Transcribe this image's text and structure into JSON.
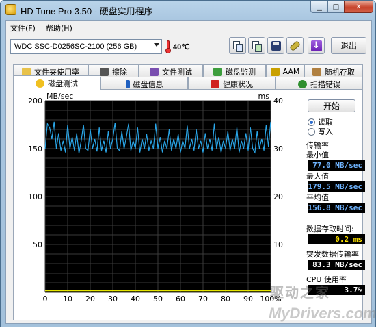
{
  "window": {
    "title": "HD Tune Pro 3.50 - 硬盘实用程序",
    "min_glyph": "▁",
    "max_glyph": "□",
    "close_glyph": "✕"
  },
  "menu": {
    "items": [
      "文件(F)",
      "帮助(H)"
    ]
  },
  "toolbar": {
    "drive": "WDC SSC-D0256SC-2100 (256 GB)",
    "temperature": "40℃",
    "exit_label": "退出",
    "exit_glyph": "↓",
    "icons": [
      "copy-text-icon",
      "copy-screenshot-icon",
      "save-icon",
      "options-icon",
      "exit-icon"
    ]
  },
  "tabs_top": [
    {
      "label": "文件夹使用率",
      "icon": "folder-icon",
      "color": "#e8c24a"
    },
    {
      "label": "擦除",
      "icon": "trash-icon",
      "color": "#555555"
    },
    {
      "label": "文件测试",
      "icon": "file-test-icon",
      "color": "#7a4fb0"
    },
    {
      "label": "磁盘监测",
      "icon": "disk-monitor-icon",
      "color": "#3d9e3d"
    },
    {
      "label": "AAM",
      "icon": "speaker-icon",
      "color": "#c9a000"
    },
    {
      "label": "随机存取",
      "icon": "random-access-icon",
      "color": "#b08040"
    }
  ],
  "tabs_bottom": [
    {
      "label": "磁盘测试",
      "icon": "benchmark-icon",
      "color": "#f0c020",
      "active": true
    },
    {
      "label": "磁盘信息",
      "icon": "info-icon",
      "color": "#2060c0",
      "active": false
    },
    {
      "label": "健康状况",
      "icon": "health-cross-icon",
      "color": "#d02020",
      "active": false
    },
    {
      "label": "扫描错误",
      "icon": "magnifier-icon",
      "color": "#2f8f2f",
      "active": false
    }
  ],
  "benchmark": {
    "start_label": "开始",
    "read_label": "读取",
    "write_label": "写入",
    "transfer_rate_label": "传输率",
    "min_label": "最小值",
    "min_value": "77.0 MB/sec",
    "max_label": "最大值",
    "max_value": "179.5 MB/sec",
    "avg_label": "平均值",
    "avg_value": "156.8 MB/sec",
    "access_time_label": "数据存取时间:",
    "access_time_value": "0.2 ms",
    "burst_rate_label": "突发数据传输率",
    "burst_rate_value": "83.3 MB/sec",
    "cpu_label": "CPU 使用率",
    "cpu_value": "3.7%"
  },
  "watermark": {
    "line1": "驱动之家",
    "line2": "MyDrivers.com"
  },
  "chart_data": {
    "type": "line",
    "ylabel": "MB/sec",
    "y2label": "ms",
    "ylim": [
      0,
      200
    ],
    "y2lim": [
      0,
      40
    ],
    "xlim": [
      0,
      100
    ],
    "y_ticks": [
      "200",
      "150",
      "100",
      "50"
    ],
    "y2_ticks": [
      "40",
      "30",
      "20",
      "10"
    ],
    "x_ticks": [
      "0",
      "10",
      "20",
      "30",
      "40",
      "50",
      "60",
      "70",
      "80",
      "90",
      "100%"
    ],
    "grid": true,
    "background": "#000000",
    "series": [
      {
        "color": "#2aa6e8",
        "x": [
          0,
          1,
          2,
          3,
          4,
          5,
          6,
          7,
          8,
          9,
          10,
          11,
          12,
          13,
          14,
          15,
          16,
          17,
          18,
          19,
          20,
          21,
          22,
          23,
          24,
          25,
          26,
          27,
          28,
          29,
          30,
          31,
          32,
          33,
          34,
          35,
          36,
          37,
          38,
          39,
          40,
          41,
          42,
          43,
          44,
          45,
          46,
          47,
          48,
          49,
          50,
          51,
          52,
          53,
          54,
          55,
          56,
          57,
          58,
          59,
          60,
          61,
          62,
          63,
          64,
          65,
          66,
          67,
          68,
          69,
          70,
          71,
          72,
          73,
          74,
          75,
          76,
          77,
          78,
          79,
          80,
          81,
          82,
          83,
          84,
          85,
          86,
          87,
          88,
          89,
          90,
          91,
          92,
          93,
          94,
          95,
          96,
          97,
          98,
          99,
          100
        ],
        "values": [
          150,
          176,
          172,
          160,
          178,
          150,
          166,
          148,
          158,
          146,
          175,
          150,
          162,
          148,
          166,
          145,
          158,
          175,
          150,
          148,
          170,
          150,
          160,
          147,
          172,
          148,
          158,
          146,
          168,
          150,
          160,
          177,
          150,
          148,
          168,
          150,
          162,
          176,
          148,
          158,
          150,
          172,
          146,
          160,
          150,
          165,
          148,
          158,
          150,
          176,
          150,
          162,
          146,
          158,
          150,
          170,
          148,
          160,
          150,
          165,
          146,
          158,
          150,
          174,
          150,
          160,
          148,
          170,
          150,
          158,
          146,
          166,
          150,
          160,
          148,
          176,
          150,
          162,
          146,
          158,
          150,
          168,
          148,
          160,
          150,
          172,
          146,
          158,
          150,
          166,
          148,
          172,
          150,
          146,
          168,
          150,
          160,
          148,
          175,
          152,
          178
        ]
      },
      {
        "color": "#e6e600",
        "x": [
          0,
          100
        ],
        "values": [
          0.4,
          0.4
        ],
        "axis": "y2"
      }
    ]
  }
}
